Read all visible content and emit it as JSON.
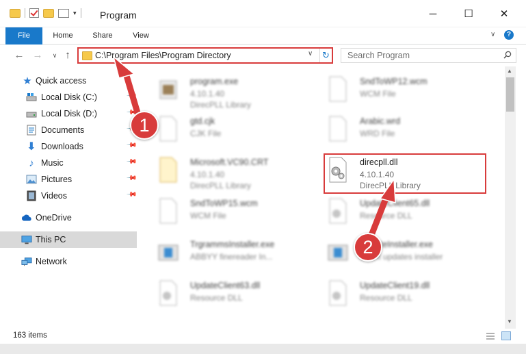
{
  "window": {
    "title": "Program",
    "controls": {
      "minimize": "─",
      "maximize": "☐",
      "close": "✕"
    }
  },
  "ribbon": {
    "tabs": [
      {
        "label": "File",
        "active": true
      },
      {
        "label": "Home"
      },
      {
        "label": "Share"
      },
      {
        "label": "View"
      }
    ],
    "help": "?"
  },
  "address": {
    "path": "C:\\Program Files\\Program Directory",
    "search_placeholder": "Search Program"
  },
  "sidebar": {
    "items": [
      {
        "label": "Quick access",
        "icon": "star-icon",
        "pinned": false
      },
      {
        "label": "Local Disk (C:)",
        "icon": "drive-icon",
        "pinned": true
      },
      {
        "label": "Local Disk (D:)",
        "icon": "drive-icon",
        "pinned": true
      },
      {
        "label": "Documents",
        "icon": "documents-icon",
        "pinned": true
      },
      {
        "label": "Downloads",
        "icon": "downloads-icon",
        "pinned": true
      },
      {
        "label": "Music",
        "icon": "music-icon",
        "pinned": true
      },
      {
        "label": "Pictures",
        "icon": "pictures-icon",
        "pinned": true
      },
      {
        "label": "Videos",
        "icon": "videos-icon",
        "pinned": true
      },
      {
        "label": "OneDrive",
        "icon": "onedrive-icon"
      },
      {
        "label": "This PC",
        "icon": "pc-icon",
        "selected": true
      },
      {
        "label": "Network",
        "icon": "network-icon"
      }
    ]
  },
  "files": [
    {
      "name": "program.exe",
      "line1": "4.10.1.40",
      "line2": "DirecPLL Library",
      "icon": "exe-icon"
    },
    {
      "name": "SndToWP12.wcm",
      "line1": "WCM File",
      "line2": "",
      "icon": "doc-icon"
    },
    {
      "name": "gtd.cjk",
      "line1": "CJK File",
      "line2": "",
      "icon": "doc-icon"
    },
    {
      "name": "Arabic.wrd",
      "line1": "WRD File",
      "line2": "",
      "icon": "doc-icon"
    },
    {
      "name": "Microsoft.VC90.CRT",
      "line1": "4.10.1.40",
      "line2": "DirecPLL Library",
      "icon": "folder-file-icon"
    },
    {
      "name": "direcpll.dll",
      "line1": "4.10.1.40",
      "line2": "DirecPLL Library",
      "icon": "dll-gear-icon",
      "highlighted": true
    },
    {
      "name": "SndToWP15.wcm",
      "line1": "WCM File",
      "line2": "",
      "icon": "doc-icon"
    },
    {
      "name": "UpdateClient65.dll",
      "line1": "Resource DLL",
      "line2": "",
      "icon": "dll-gear-icon"
    },
    {
      "name": "TrgrammsInstaller.exe",
      "line1": "ABBYY finereader In...",
      "line2": "",
      "icon": "installer-icon"
    },
    {
      "name": "UpdateInstaller.exe",
      "line1": "Client updates installer",
      "line2": "",
      "icon": "installer-icon"
    },
    {
      "name": "UpdateClient63.dll",
      "line1": "Resource DLL",
      "line2": "",
      "icon": "dll-gear-icon"
    },
    {
      "name": "UpdateClient19.dll",
      "line1": "Resource DLL",
      "line2": "",
      "icon": "dll-gear-icon"
    }
  ],
  "status": {
    "item_count": "163 items"
  },
  "annotations": {
    "step1": "1",
    "step2": "2",
    "color": "#d83b3b"
  }
}
